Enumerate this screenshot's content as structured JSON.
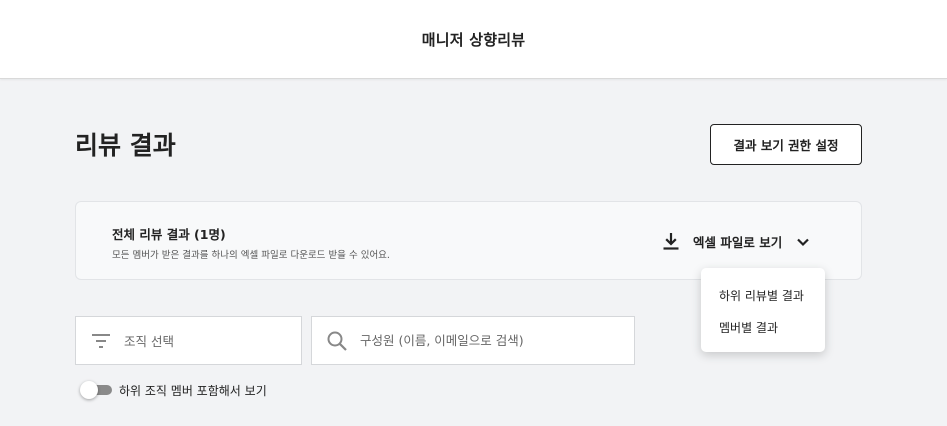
{
  "header": {
    "title": "매니저 상향리뷰"
  },
  "page": {
    "title": "리뷰 결과",
    "permission_button": "결과 보기 권한 설정"
  },
  "summary_card": {
    "title": "전체 리뷰 결과 (1명)",
    "description": "모든 멤버가 받은 결과를 하나의 엑셀 파일로 다운로드 받을 수 있어요.",
    "excel_button": "엑셀 파일로 보기",
    "icons": {
      "download": "download-icon",
      "toggle": "chevron-down-icon"
    }
  },
  "dropdown": {
    "items": [
      {
        "label": "하위 리뷰별 결과"
      },
      {
        "label": "멤버별 결과"
      }
    ]
  },
  "filters": {
    "org_select": {
      "placeholder": "조직 선택",
      "icon": "filter-icon"
    },
    "member_search": {
      "placeholder": "구성원 (이름, 이메일으로 검색)",
      "icon": "search-icon"
    },
    "include_sub_org": {
      "label": "하위 조직 멤버 포함해서 보기",
      "checked": false
    }
  },
  "colors": {
    "background": "#f2f3f5",
    "card": "#f8f9fa",
    "text": "#222222",
    "toggle_track": "#8a8a8a"
  }
}
